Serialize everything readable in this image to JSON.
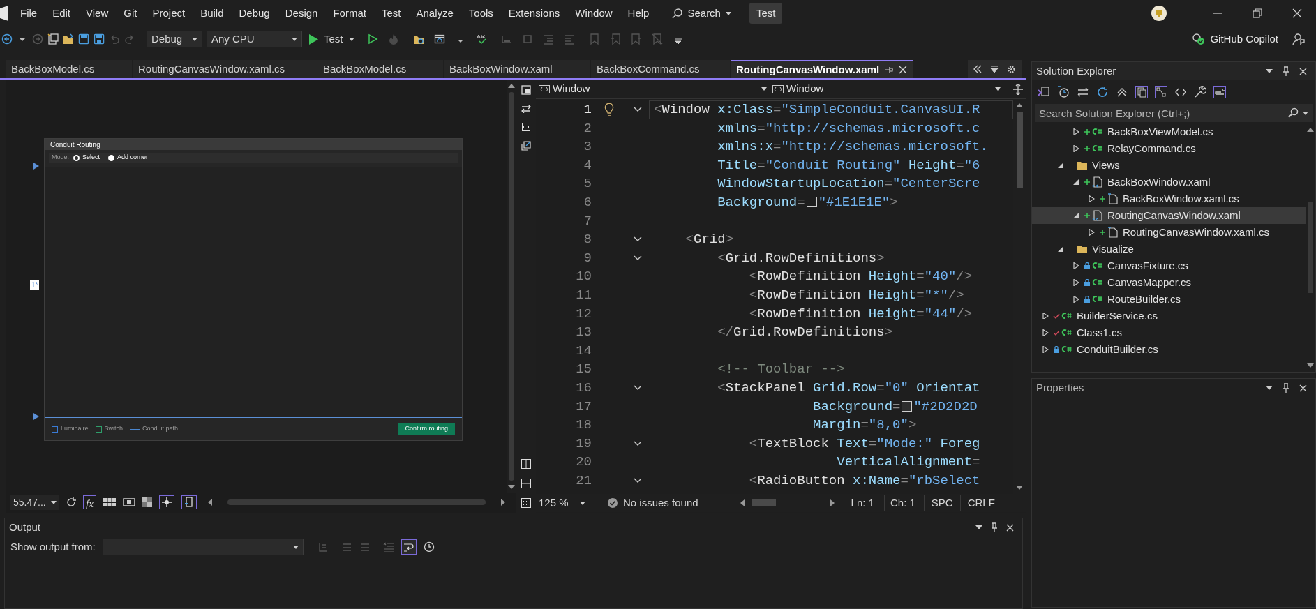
{
  "menu": [
    "File",
    "Edit",
    "View",
    "Git",
    "Project",
    "Build",
    "Debug",
    "Design",
    "Format",
    "Test",
    "Analyze",
    "Tools",
    "Extensions",
    "Window",
    "Help"
  ],
  "search": {
    "label": "Search"
  },
  "solution_name": "Test",
  "toolbar": {
    "configuration": "Debug",
    "platform": "Any CPU",
    "start": "Test"
  },
  "copilot": {
    "label": "GitHub Copilot"
  },
  "tabs": [
    {
      "label": "BackBoxModel.cs",
      "selected": false
    },
    {
      "label": "RoutingCanvasWindow.xaml.cs",
      "selected": false
    },
    {
      "label": "BackBoxModel.cs",
      "selected": false
    },
    {
      "label": "BackBoxWindow.xaml",
      "selected": false
    },
    {
      "label": "BackBoxCommand.cs",
      "selected": false
    },
    {
      "label": "RoutingCanvasWindow.xaml",
      "selected": true
    }
  ],
  "designer": {
    "zoom": "55.47...",
    "fx_button": "fx",
    "preview": {
      "title": "Conduit Routing",
      "mode_label": "Mode:",
      "row_marker": "1*",
      "modes": [
        {
          "label": "Select",
          "selected": true
        },
        {
          "label": "Add corner",
          "selected": false
        }
      ],
      "legend": [
        {
          "kind": "box",
          "label": "Luminaire",
          "color": "#3a7bd5"
        },
        {
          "kind": "box",
          "label": "Switch",
          "color": "#2e9e6a"
        },
        {
          "kind": "line",
          "label": "Conduit path",
          "color": "#4a86d0"
        }
      ],
      "button": "Confirm routing"
    }
  },
  "editor": {
    "left_scope": "Window",
    "right_scope": "Window",
    "zoom": "125 %",
    "issues": "No issues found",
    "line": "Ln: 1",
    "column": "Ch: 1",
    "whitespace": "SPC",
    "line_ending": "CRLF",
    "lines": [
      {
        "number": "1",
        "current": true,
        "fold": true,
        "hint": true,
        "tokens": [
          {
            "kind": "punct",
            "text": "<"
          },
          {
            "kind": "element",
            "text": "Window"
          },
          {
            "kind": "attribute",
            "text": " x:Class"
          },
          {
            "kind": "punct",
            "text": "="
          },
          {
            "kind": "value",
            "text": "\"SimpleConduit.CanvasUI.R"
          }
        ]
      },
      {
        "number": "2",
        "current": false,
        "fold": false,
        "hint": false,
        "tokens": [
          {
            "kind": "attribute",
            "text": "        xmlns"
          },
          {
            "kind": "punct",
            "text": "="
          },
          {
            "kind": "value",
            "text": "\"http://schemas.microsoft.c"
          }
        ]
      },
      {
        "number": "3",
        "current": false,
        "fold": false,
        "hint": false,
        "tokens": [
          {
            "kind": "attribute",
            "text": "        xmlns:x"
          },
          {
            "kind": "punct",
            "text": "="
          },
          {
            "kind": "value",
            "text": "\"http://schemas.microsoft."
          }
        ]
      },
      {
        "number": "4",
        "current": false,
        "fold": false,
        "hint": false,
        "tokens": [
          {
            "kind": "attribute",
            "text": "        Title"
          },
          {
            "kind": "punct",
            "text": "="
          },
          {
            "kind": "value",
            "text": "\"Conduit Routing\""
          },
          {
            "kind": "attribute",
            "text": " Height"
          },
          {
            "kind": "punct",
            "text": "="
          },
          {
            "kind": "value",
            "text": "\"6"
          }
        ]
      },
      {
        "number": "5",
        "current": false,
        "fold": false,
        "hint": false,
        "tokens": [
          {
            "kind": "attribute",
            "text": "        WindowStartupLocation"
          },
          {
            "kind": "punct",
            "text": "="
          },
          {
            "kind": "value",
            "text": "\"CenterScre"
          }
        ]
      },
      {
        "number": "6",
        "current": false,
        "fold": false,
        "hint": false,
        "tokens": [
          {
            "kind": "attribute",
            "text": "        Background"
          },
          {
            "kind": "punct",
            "text": "="
          },
          {
            "kind": "swatch",
            "color": "#1e1e1e"
          },
          {
            "kind": "value",
            "text": "\"#1E1E1E\""
          },
          {
            "kind": "punct",
            "text": ">"
          }
        ]
      },
      {
        "number": "7",
        "current": false,
        "fold": false,
        "hint": false
      },
      {
        "number": "8",
        "current": false,
        "fold": true,
        "hint": false,
        "tokens": [
          {
            "kind": "punct",
            "text": "    <"
          },
          {
            "kind": "element",
            "text": "Grid"
          },
          {
            "kind": "punct",
            "text": ">"
          }
        ]
      },
      {
        "number": "9",
        "current": false,
        "fold": true,
        "hint": false,
        "tokens": [
          {
            "kind": "punct",
            "text": "        <"
          },
          {
            "kind": "element",
            "text": "Grid.RowDefinitions"
          },
          {
            "kind": "punct",
            "text": ">"
          }
        ]
      },
      {
        "number": "10",
        "current": false,
        "fold": false,
        "hint": false,
        "tokens": [
          {
            "kind": "punct",
            "text": "            <"
          },
          {
            "kind": "element",
            "text": "RowDefinition"
          },
          {
            "kind": "attribute",
            "text": " Height"
          },
          {
            "kind": "punct",
            "text": "="
          },
          {
            "kind": "value",
            "text": "\"40\""
          },
          {
            "kind": "punct",
            "text": "/>"
          }
        ]
      },
      {
        "number": "11",
        "current": false,
        "fold": false,
        "hint": false,
        "tokens": [
          {
            "kind": "punct",
            "text": "            <"
          },
          {
            "kind": "element",
            "text": "RowDefinition"
          },
          {
            "kind": "attribute",
            "text": " Height"
          },
          {
            "kind": "punct",
            "text": "="
          },
          {
            "kind": "value",
            "text": "\"*\""
          },
          {
            "kind": "punct",
            "text": "/>"
          }
        ]
      },
      {
        "number": "12",
        "current": false,
        "fold": false,
        "hint": false,
        "tokens": [
          {
            "kind": "punct",
            "text": "            <"
          },
          {
            "kind": "element",
            "text": "RowDefinition"
          },
          {
            "kind": "attribute",
            "text": " Height"
          },
          {
            "kind": "punct",
            "text": "="
          },
          {
            "kind": "value",
            "text": "\"44\""
          },
          {
            "kind": "punct",
            "text": "/>"
          }
        ]
      },
      {
        "number": "13",
        "current": false,
        "fold": false,
        "hint": false,
        "tokens": [
          {
            "kind": "punct",
            "text": "        </"
          },
          {
            "kind": "element",
            "text": "Grid.RowDefinitions"
          },
          {
            "kind": "punct",
            "text": ">"
          }
        ]
      },
      {
        "number": "14",
        "current": false,
        "fold": false,
        "hint": false
      },
      {
        "number": "15",
        "current": false,
        "fold": false,
        "hint": false,
        "tokens": [
          {
            "kind": "comment",
            "text": "        <!-- Toolbar -->"
          }
        ]
      },
      {
        "number": "16",
        "current": false,
        "fold": true,
        "hint": false,
        "tokens": [
          {
            "kind": "punct",
            "text": "        <"
          },
          {
            "kind": "element",
            "text": "StackPanel"
          },
          {
            "kind": "attribute",
            "text": " Grid.Row"
          },
          {
            "kind": "punct",
            "text": "="
          },
          {
            "kind": "value",
            "text": "\"0\""
          },
          {
            "kind": "attribute",
            "text": " Orientat"
          }
        ]
      },
      {
        "number": "17",
        "current": false,
        "fold": false,
        "hint": false,
        "tokens": [
          {
            "kind": "attribute",
            "text": "                    Background"
          },
          {
            "kind": "punct",
            "text": "="
          },
          {
            "kind": "swatch",
            "color": "#2d2d2d"
          },
          {
            "kind": "value",
            "text": "\"#2D2D2D"
          }
        ]
      },
      {
        "number": "18",
        "current": false,
        "fold": false,
        "hint": false,
        "tokens": [
          {
            "kind": "attribute",
            "text": "                    Margin"
          },
          {
            "kind": "punct",
            "text": "="
          },
          {
            "kind": "value",
            "text": "\"8,0\""
          },
          {
            "kind": "punct",
            "text": ">"
          }
        ]
      },
      {
        "number": "19",
        "current": false,
        "fold": true,
        "hint": false,
        "tokens": [
          {
            "kind": "punct",
            "text": "            <"
          },
          {
            "kind": "element",
            "text": "TextBlock"
          },
          {
            "kind": "attribute",
            "text": " Text"
          },
          {
            "kind": "punct",
            "text": "="
          },
          {
            "kind": "value",
            "text": "\"Mode:\""
          },
          {
            "kind": "attribute",
            "text": " Foreg"
          }
        ]
      },
      {
        "number": "20",
        "current": false,
        "fold": false,
        "hint": false,
        "tokens": [
          {
            "kind": "attribute",
            "text": "                       VerticalAlignment"
          },
          {
            "kind": "punct",
            "text": "="
          }
        ]
      },
      {
        "number": "21",
        "current": false,
        "fold": true,
        "hint": false,
        "tokens": [
          {
            "kind": "punct",
            "text": "            <"
          },
          {
            "kind": "element",
            "text": "RadioButton"
          },
          {
            "kind": "attribute",
            "text": " x:Name"
          },
          {
            "kind": "punct",
            "text": "="
          },
          {
            "kind": "value",
            "text": "\"rbSelect"
          }
        ]
      }
    ]
  },
  "solution_explorer": {
    "title": "Solution Explorer",
    "search": {
      "placeholder": "Search Solution Explorer (Ctrl+;)"
    },
    "tree": [
      {
        "children": [
          {
            "children": [
              {
                "label": "BackBoxViewModel.cs",
                "kind": "cs",
                "added": true,
                "locked": false,
                "checked": false,
                "expanded": false,
                "selected": false
              },
              {
                "label": "RelayCommand.cs",
                "kind": "cs",
                "added": true,
                "locked": false,
                "checked": false,
                "expanded": false,
                "selected": false
              }
            ]
          },
          {
            "label": "Views",
            "kind": "folder",
            "added": false,
            "locked": false,
            "checked": false,
            "expanded": true,
            "selected": false,
            "children": [
              {
                "label": "BackBoxWindow.xaml",
                "kind": "xaml",
                "added": true,
                "locked": false,
                "checked": false,
                "expanded": true,
                "selected": false,
                "children": [
                  {
                    "label": "BackBoxWindow.xaml.cs",
                    "kind": "code",
                    "added": true,
                    "locked": false,
                    "checked": false,
                    "expanded": false,
                    "selected": false
                  }
                ]
              },
              {
                "label": "RoutingCanvasWindow.xaml",
                "kind": "xaml",
                "added": true,
                "locked": false,
                "checked": false,
                "expanded": true,
                "selected": true,
                "children": [
                  {
                    "label": "RoutingCanvasWindow.xaml.cs",
                    "kind": "code",
                    "added": true,
                    "locked": false,
                    "checked": false,
                    "expanded": false,
                    "selected": false
                  }
                ]
              }
            ]
          },
          {
            "label": "Visualize",
            "kind": "folder",
            "added": false,
            "locked": false,
            "checked": false,
            "expanded": true,
            "selected": false,
            "children": [
              {
                "label": "CanvasFixture.cs",
                "kind": "cs",
                "added": false,
                "locked": true,
                "checked": false,
                "expanded": false,
                "selected": false
              },
              {
                "label": "CanvasMapper.cs",
                "kind": "cs",
                "added": false,
                "locked": true,
                "checked": false,
                "expanded": false,
                "selected": false
              },
              {
                "label": "RouteBuilder.cs",
                "kind": "cs",
                "added": false,
                "locked": true,
                "checked": false,
                "expanded": false,
                "selected": false
              }
            ]
          }
        ]
      },
      {
        "label": "BuilderService.cs",
        "kind": "cs",
        "added": false,
        "locked": false,
        "checked": true,
        "expanded": false,
        "selected": false
      },
      {
        "label": "Class1.cs",
        "kind": "cs",
        "added": false,
        "locked": false,
        "checked": true,
        "expanded": false,
        "selected": false
      },
      {
        "label": "ConduitBuilder.cs",
        "kind": "cs",
        "added": false,
        "locked": true,
        "checked": false,
        "expanded": false,
        "selected": false
      }
    ]
  },
  "properties": {
    "title": "Properties"
  },
  "output": {
    "title": "Output",
    "show_from_label": "Show output from:"
  }
}
